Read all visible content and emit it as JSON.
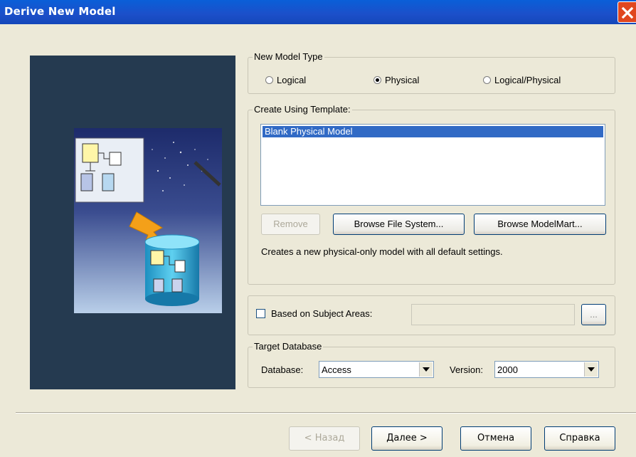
{
  "window": {
    "title": "Derive New Model"
  },
  "model_type": {
    "legend": "New Model Type",
    "options": [
      {
        "label": "Logical",
        "selected": false
      },
      {
        "label": "Physical",
        "selected": true
      },
      {
        "label": "Logical/Physical",
        "selected": false
      }
    ]
  },
  "template": {
    "legend": "Create Using Template:",
    "items": [
      "Blank Physical Model"
    ],
    "selected": "Blank Physical Model",
    "remove_label": "Remove",
    "browse_fs_label": "Browse File System...",
    "browse_mm_label": "Browse ModelMart...",
    "description": "Creates a new physical-only model with all default settings."
  },
  "subject_areas": {
    "label": "Based on Subject Areas:",
    "checked": false,
    "value": "",
    "browse_label": "..."
  },
  "target_db": {
    "legend": "Target Database",
    "database_label": "Database:",
    "database_value": "Access",
    "version_label": "Version:",
    "version_value": "2000"
  },
  "footer": {
    "back_label": "< Назад",
    "next_label": "Далее >",
    "cancel_label": "Отмена",
    "help_label": "Справка"
  },
  "icons": [
    "close-icon",
    "model-wizard-illustration",
    "dropdown-arrow-icon"
  ]
}
